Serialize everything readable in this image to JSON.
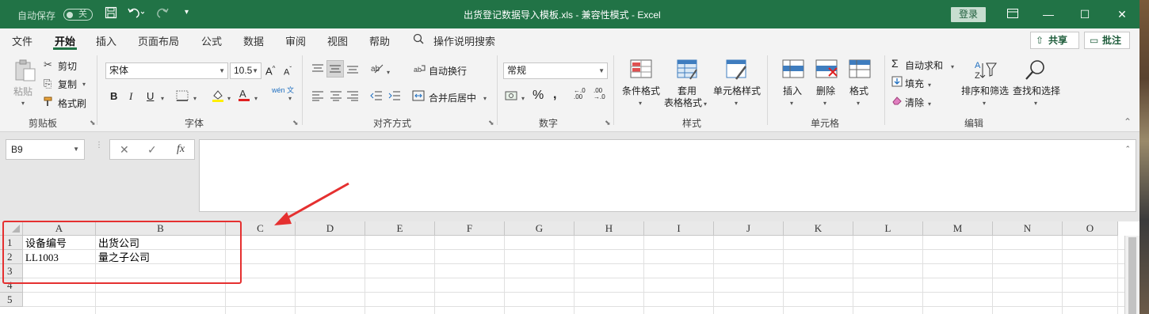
{
  "titlebar": {
    "autosave_label": "自动保存",
    "autosave_state": "关",
    "title": "出货登记数据导入模板.xls  -  兼容性模式  -  Excel",
    "login": "登录"
  },
  "tabs": [
    "文件",
    "开始",
    "插入",
    "页面布局",
    "公式",
    "数据",
    "审阅",
    "视图",
    "帮助"
  ],
  "search": {
    "label": "操作说明搜索"
  },
  "share_label": "共享",
  "comment_label": "批注",
  "clipboard": {
    "paste": "粘贴",
    "cut": "剪切",
    "copy": "复制",
    "format_painter": "格式刷",
    "label": "剪贴板"
  },
  "font": {
    "name": "宋体",
    "size": "10.5",
    "bold": "B",
    "italic": "I",
    "underline": "U",
    "label": "字体",
    "wen": "wén 文"
  },
  "alignment": {
    "wrap": "自动换行",
    "merge": "合并后居中",
    "label": "对齐方式"
  },
  "number": {
    "format": "常规",
    "label": "数字"
  },
  "styles": {
    "conditional": "条件格式",
    "table_line1": "套用",
    "table_line2": "表格格式",
    "cell_styles": "单元格样式",
    "label": "样式"
  },
  "cells": {
    "insert": "插入",
    "delete": "删除",
    "format": "格式",
    "label": "单元格"
  },
  "editing": {
    "autosum": "自动求和",
    "fill": "填充",
    "clear": "清除",
    "sort": "排序和筛选",
    "find": "查找和选择",
    "label": "编辑"
  },
  "namebox": "B9",
  "columns": [
    "A",
    "B",
    "C",
    "D",
    "E",
    "F",
    "G",
    "H",
    "I",
    "J",
    "K",
    "L",
    "M",
    "N",
    "O"
  ],
  "rows": [
    "1",
    "2",
    "3",
    "4",
    "5"
  ],
  "cells_data": {
    "A1": "设备编号",
    "B1": "出货公司",
    "A2": "LL1003",
    "B2": "量之子公司"
  },
  "accent_color": "#217346",
  "annotation_color": "#e53030"
}
